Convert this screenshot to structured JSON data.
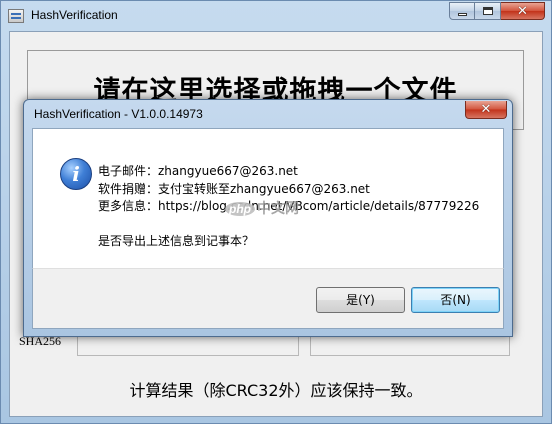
{
  "main_window": {
    "title": "HashVerification",
    "drop_zone_text": "请在这里选择或拖拽一个文件",
    "hash_label": "SHA256",
    "footer_text": "计算结果（除CRC32外）应该保持一致。",
    "caption_buttons": {
      "close_glyph": "✕"
    }
  },
  "dialog": {
    "title": "HashVerification - V1.0.0.14973",
    "icon": "info-icon",
    "icon_glyph": "i",
    "lines": [
      "电子邮件：zhangyue667@263.net",
      "软件捐赠：支付宝转账至zhangyue667@263.net",
      "更多信息：https://blog.csdn.net/VBcom/article/details/87779226"
    ],
    "question": "是否导出上述信息到记事本？",
    "close_glyph": "✕",
    "buttons": {
      "yes": "是(Y)",
      "no": "否(N)"
    }
  },
  "watermark": {
    "logo": "php",
    "text": "中文网"
  },
  "colors": {
    "accent": "#3f7fd6",
    "close_red": "#c2321a",
    "chrome": "#b9d3ea"
  }
}
